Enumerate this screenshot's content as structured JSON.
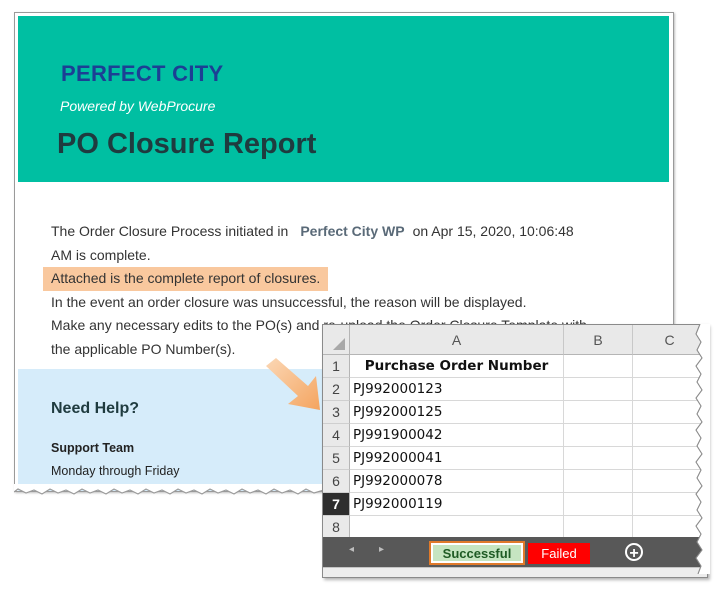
{
  "email": {
    "brand": "PERFECT CITY",
    "powered_by": "Powered by WebProcure",
    "title": "PO Closure Report",
    "line1_prefix": "The Order Closure Process initiated in",
    "line1_org": "Perfect City WP",
    "line1_suffix": "on Apr 15, 2020, 10:06:48",
    "line2": "AM is complete.",
    "line3": "Attached is the complete report of closures.",
    "line4": "In the event an order closure was unsuccessful, the reason will be displayed.",
    "line5": "Make any necessary edits to the PO(s) and re-upload the Order Closure Template with",
    "line6": "the applicable PO Number(s).",
    "help_title": "Need Help?",
    "support_team": "Support Team",
    "support_hours": "Monday through Friday"
  },
  "sheet": {
    "columns": [
      "A",
      "B",
      "C"
    ],
    "rows": [
      "1",
      "2",
      "3",
      "4",
      "5",
      "6",
      "7",
      "8"
    ],
    "header": "Purchase Order Number",
    "cells": [
      "PJ992000123",
      "PJ992000125",
      "PJ991900042",
      "PJ992000041",
      "PJ992000078",
      "PJ992000119"
    ],
    "active_row": "7",
    "tabs": {
      "successful": "Successful",
      "failed": "Failed",
      "add": "+"
    },
    "nav": {
      "prev": "◂",
      "next": "▸"
    },
    "colors": {
      "tab_highlight": "#e07a2a",
      "failed_tab": "#ff0000",
      "successful_tab": "#c6e5c1"
    }
  }
}
